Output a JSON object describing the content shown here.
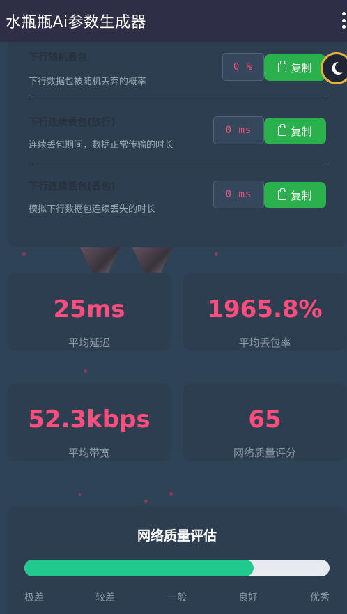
{
  "app": {
    "title": "水瓶瓶Ai参数生成器"
  },
  "settings": [
    {
      "label": "下行随机丢包",
      "description": "下行数据包被随机丢弃的概率",
      "value": "0 %",
      "copy_label": "复制"
    },
    {
      "label": "下行连续丢包(放行)",
      "description": "连续丢包期间，数据正常传输的时长",
      "value": "0 ms",
      "copy_label": "复制"
    },
    {
      "label": "下行连续丢包(丢包)",
      "description": "模拟下行数据包连续丢失的时长",
      "value": "0 ms",
      "copy_label": "复制"
    }
  ],
  "stats": [
    {
      "value": "25ms",
      "label": "平均延迟"
    },
    {
      "value": "1965.8%",
      "label": "平均丢包率"
    },
    {
      "value": "52.3kbps",
      "label": "平均带宽"
    },
    {
      "value": "65",
      "label": "网络质量评分"
    }
  ],
  "quality": {
    "title": "网络质量评估",
    "progress_percent": 75,
    "scale": [
      "极差",
      "较差",
      "一般",
      "良好",
      "优秀"
    ]
  },
  "colors": {
    "accent": "#ff4d7d",
    "success": "#2ab14d",
    "progress": "#22c98e",
    "toggle_ring": "#e5b33a"
  },
  "icons": {
    "theme_toggle": "moon-icon",
    "copy": "clipboard-icon",
    "menu": "more-vert-icon"
  }
}
